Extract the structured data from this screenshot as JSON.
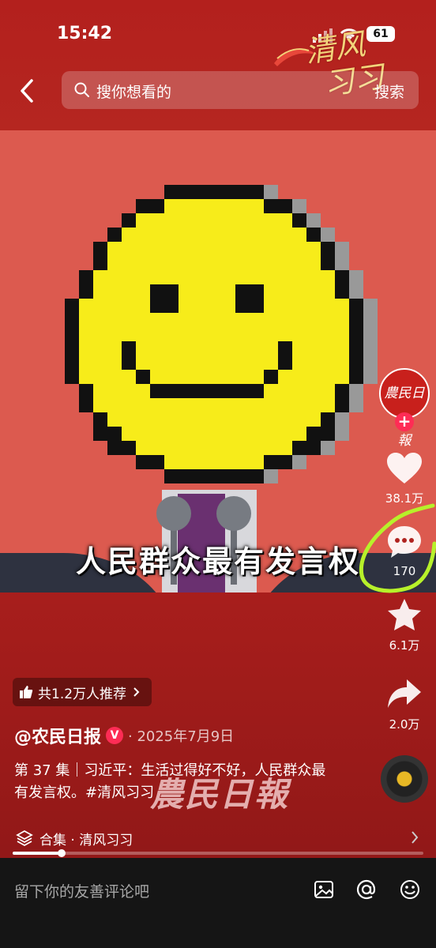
{
  "status_bar": {
    "time": "15:42",
    "battery": "61"
  },
  "brand": {
    "line1": "清风",
    "line2": "习习"
  },
  "search": {
    "placeholder": "搜你想看的",
    "button": "搜索"
  },
  "video": {
    "caption": "人民群众最有发言权"
  },
  "rail": {
    "avatar_text": "農民日報",
    "like_count": "38.1万",
    "comment_count": "170",
    "favorite_count": "6.1万",
    "share_count": "2.0万"
  },
  "recommend": {
    "label": "共1.2万人推荐"
  },
  "author": {
    "name": "@农民日报",
    "verified": "V",
    "date": "· 2025年7月9日"
  },
  "description": "第 37 集｜习近平：生活过得好不好，人民群众最有发言权。#清风习习",
  "watermark": "農民日報",
  "collection": {
    "label": "合集 · 清风习习"
  },
  "progress": {
    "fraction": 0.12
  },
  "comment_bar": {
    "placeholder": "留下你的友善评论吧"
  },
  "colors": {
    "accent": "#fe2c55",
    "highlight": "#b7f12a"
  }
}
